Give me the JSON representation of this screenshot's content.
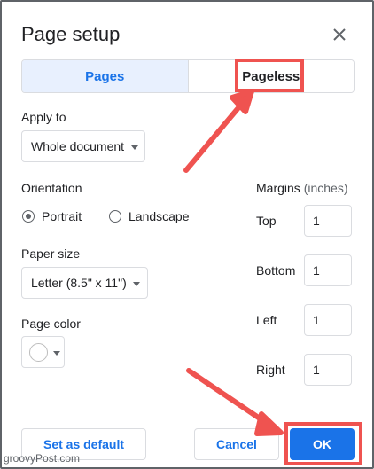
{
  "dialog": {
    "title": "Page setup",
    "close_icon": "close-icon"
  },
  "tabs": [
    {
      "label": "Pages",
      "active": true
    },
    {
      "label": "Pageless",
      "active": false
    }
  ],
  "apply_to": {
    "label": "Apply to",
    "value": "Whole document"
  },
  "orientation": {
    "label": "Orientation",
    "options": [
      {
        "label": "Portrait",
        "checked": true
      },
      {
        "label": "Landscape",
        "checked": false
      }
    ]
  },
  "paper_size": {
    "label": "Paper size",
    "value": "Letter (8.5\" x 11\")"
  },
  "page_color": {
    "label": "Page color",
    "value": "#ffffff"
  },
  "margins": {
    "label": "Margins",
    "unit": "(inches)",
    "fields": [
      {
        "label": "Top",
        "value": "1"
      },
      {
        "label": "Bottom",
        "value": "1"
      },
      {
        "label": "Left",
        "value": "1"
      },
      {
        "label": "Right",
        "value": "1"
      }
    ]
  },
  "footer": {
    "set_default_label": "Set as default",
    "cancel_label": "Cancel",
    "ok_label": "OK"
  },
  "watermark": "groovyPost.com",
  "colors": {
    "accent": "#1a73e8",
    "tab_active_bg": "#e8f0fe",
    "annotation": "#ef5350"
  }
}
